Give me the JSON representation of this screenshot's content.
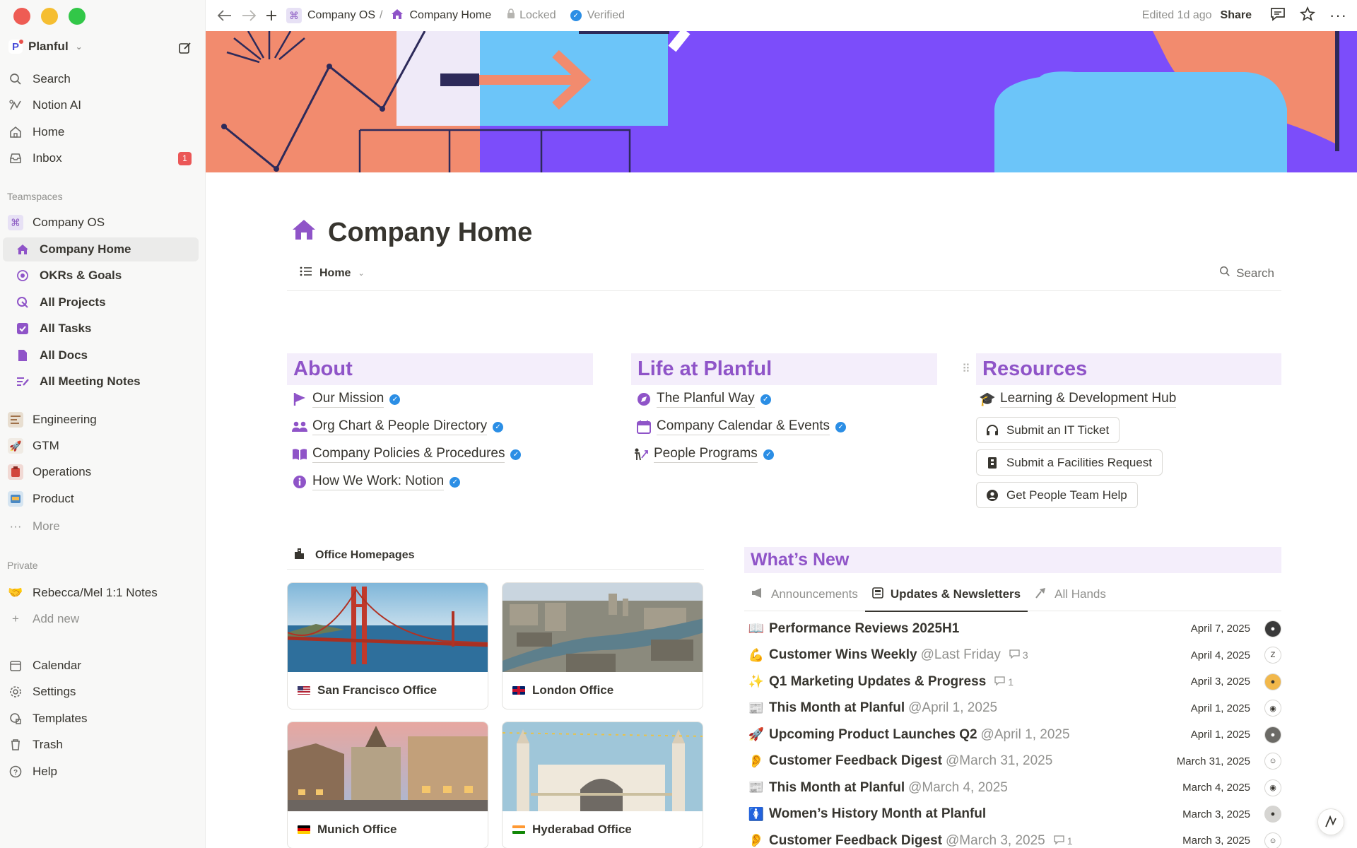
{
  "sidebar": {
    "workspace": "Planful",
    "top_items": [
      {
        "label": "Search",
        "icon": "search-icon"
      },
      {
        "label": "Notion AI",
        "icon": "notion-ai-icon"
      },
      {
        "label": "Home",
        "icon": "home-icon"
      },
      {
        "label": "Inbox",
        "icon": "inbox-icon",
        "badge": "1"
      }
    ],
    "teamspaces_label": "Teamspaces",
    "teamspace": "Company OS",
    "teamspace_pages": [
      {
        "label": "Company Home",
        "icon": "house-icon"
      },
      {
        "label": "OKRs & Goals",
        "icon": "target-icon"
      },
      {
        "label": "All Projects",
        "icon": "projects-icon"
      },
      {
        "label": "All Tasks",
        "icon": "checkbox-icon"
      },
      {
        "label": "All Docs",
        "icon": "doc-icon"
      },
      {
        "label": "All Meeting Notes",
        "icon": "notes-icon"
      }
    ],
    "other_teamspaces": [
      {
        "label": "Engineering",
        "icon": "engineering-icon"
      },
      {
        "label": "GTM",
        "icon": "rocket-icon"
      },
      {
        "label": "Operations",
        "icon": "operations-icon"
      },
      {
        "label": "Product",
        "icon": "product-icon"
      }
    ],
    "more_label": "More",
    "private_label": "Private",
    "private_pages": [
      {
        "label": "Rebecca/Mel 1:1 Notes",
        "icon": "handshake-icon"
      }
    ],
    "add_new_label": "Add new",
    "bottom_items": [
      {
        "label": "Calendar",
        "icon": "calendar-icon"
      },
      {
        "label": "Settings",
        "icon": "gear-icon"
      },
      {
        "label": "Templates",
        "icon": "templates-icon"
      },
      {
        "label": "Trash",
        "icon": "trash-icon"
      },
      {
        "label": "Help",
        "icon": "help-icon"
      }
    ]
  },
  "topbar": {
    "breadcrumb_parent": "Company OS",
    "breadcrumb_sep": "/",
    "breadcrumb_current": "Company Home",
    "locked_label": "Locked",
    "verified_label": "Verified",
    "edited_label": "Edited 1d ago",
    "share_label": "Share"
  },
  "page": {
    "title": "Company Home",
    "view_tab": "Home",
    "search_label": "Search"
  },
  "about": {
    "heading": "About",
    "links": [
      {
        "label": "Our Mission",
        "icon": "flag-icon"
      },
      {
        "label": "Org Chart & People Directory",
        "icon": "people-icon"
      },
      {
        "label": "Company Policies & Procedures",
        "icon": "book-icon"
      },
      {
        "label": "How We Work: Notion",
        "icon": "info-icon"
      }
    ]
  },
  "life": {
    "heading": "Life at Planful",
    "links": [
      {
        "label": "The Planful Way",
        "icon": "compass-icon"
      },
      {
        "label": "Company Calendar & Events",
        "icon": "calendar-icon"
      },
      {
        "label": "People Programs",
        "icon": "programs-icon"
      }
    ]
  },
  "resources": {
    "heading": "Resources",
    "link": {
      "label": "Learning & Development Hub",
      "icon": "graduation-cap-icon"
    },
    "buttons": [
      {
        "label": "Submit an IT Ticket",
        "icon": "headset-icon"
      },
      {
        "label": "Submit a Facilities Request",
        "icon": "building-icon"
      },
      {
        "label": "Get People Team Help",
        "icon": "person-bubble-icon"
      }
    ]
  },
  "offices": {
    "heading": "Office Homepages",
    "cards": [
      {
        "label": "San Francisco Office",
        "flag": "us-flag-icon"
      },
      {
        "label": "London Office",
        "flag": "uk-flag-icon"
      },
      {
        "label": "Munich Office",
        "flag": "de-flag-icon"
      },
      {
        "label": "Hyderabad Office",
        "flag": "in-flag-icon"
      }
    ]
  },
  "whats_new": {
    "heading": "What’s New",
    "tabs": [
      {
        "label": "Announcements",
        "icon": "megaphone-icon"
      },
      {
        "label": "Updates & Newsletters",
        "icon": "newspaper-icon"
      },
      {
        "label": "All Hands",
        "icon": "all-hands-icon"
      }
    ],
    "rows": [
      {
        "emoji": "📖",
        "title": "Performance Reviews 2025H1",
        "mention": "",
        "comments": "",
        "date": "April 7, 2025"
      },
      {
        "emoji": "💪",
        "title": "Customer Wins Weekly",
        "mention": "@Last Friday",
        "comments": "3",
        "date": "April 4, 2025"
      },
      {
        "emoji": "✨",
        "title": "Q1 Marketing Updates & Progress",
        "mention": "",
        "comments": "1",
        "date": "April 3, 2025"
      },
      {
        "emoji": "📰",
        "title": "This Month at Planful",
        "mention": "@April 1, 2025",
        "comments": "",
        "date": "April 1, 2025"
      },
      {
        "emoji": "🚀",
        "title": "Upcoming Product Launches Q2",
        "mention": "@April 1, 2025",
        "comments": "",
        "date": "April 1, 2025"
      },
      {
        "emoji": "👂",
        "title": "Customer Feedback Digest",
        "mention": "@March 31, 2025",
        "comments": "",
        "date": "March 31, 2025"
      },
      {
        "emoji": "📰",
        "title": "This Month at Planful",
        "mention": "@March 4, 2025",
        "comments": "",
        "date": "March 4, 2025"
      },
      {
        "emoji": "🚺",
        "title": "Women’s History Month at Planful",
        "mention": "",
        "comments": "",
        "date": "March 3, 2025"
      },
      {
        "emoji": "👂",
        "title": "Customer Feedback Digest",
        "mention": "@March 3, 2025",
        "comments": "1",
        "date": "March 3, 2025"
      }
    ]
  },
  "colors": {
    "accent_purple": "#8f54c8",
    "heading_bg": "#f4eefb",
    "verified_blue": "#2b8ee5",
    "badge_red": "#eb5757"
  }
}
